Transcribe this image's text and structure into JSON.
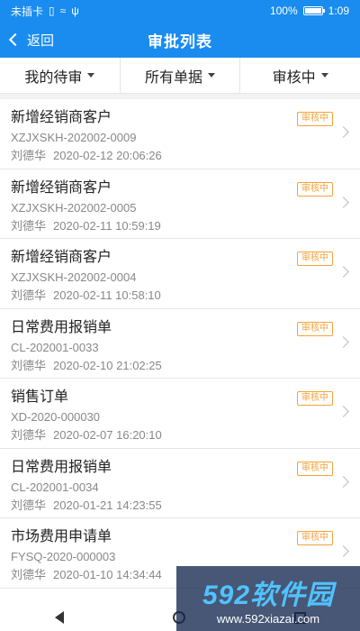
{
  "status_bar": {
    "carrier": "未插卡",
    "battery_percent": "100%",
    "battery_level": 1.0,
    "time": "1:09"
  },
  "nav": {
    "back_label": "返回",
    "title": "审批列表"
  },
  "filters": [
    {
      "label": "我的待审"
    },
    {
      "label": "所有单据"
    },
    {
      "label": "审核中"
    }
  ],
  "items": [
    {
      "title": "新增经销商客户",
      "code": "XZJXSKH-202002-0009",
      "user": "刘德华",
      "datetime": "2020-02-12 20:06:26",
      "status": "审核中"
    },
    {
      "title": "新增经销商客户",
      "code": "XZJXSKH-202002-0005",
      "user": "刘德华",
      "datetime": "2020-02-11 10:59:19",
      "status": "审核中"
    },
    {
      "title": "新增经销商客户",
      "code": "XZJXSKH-202002-0004",
      "user": "刘德华",
      "datetime": "2020-02-11 10:58:10",
      "status": "审核中"
    },
    {
      "title": "日常费用报销单",
      "code": "CL-202001-0033",
      "user": "刘德华",
      "datetime": "2020-02-10 21:02:25",
      "status": "审核中"
    },
    {
      "title": "销售订单",
      "code": "XD-2020-000030",
      "user": "刘德华",
      "datetime": "2020-02-07 16:20:10",
      "status": "审核中"
    },
    {
      "title": "日常费用报销单",
      "code": "CL-202001-0034",
      "user": "刘德华",
      "datetime": "2020-01-21 14:23:55",
      "status": "审核中"
    },
    {
      "title": "市场费用申请单",
      "code": "FYSQ-2020-000003",
      "user": "刘德华",
      "datetime": "2020-01-10 14:34:44",
      "status": "审核中"
    }
  ],
  "watermark": {
    "brand": "592软件园",
    "url": "www.592xiazai.com"
  },
  "colors": {
    "primary": "#1a8cf0",
    "badge": "#f5a23b"
  }
}
